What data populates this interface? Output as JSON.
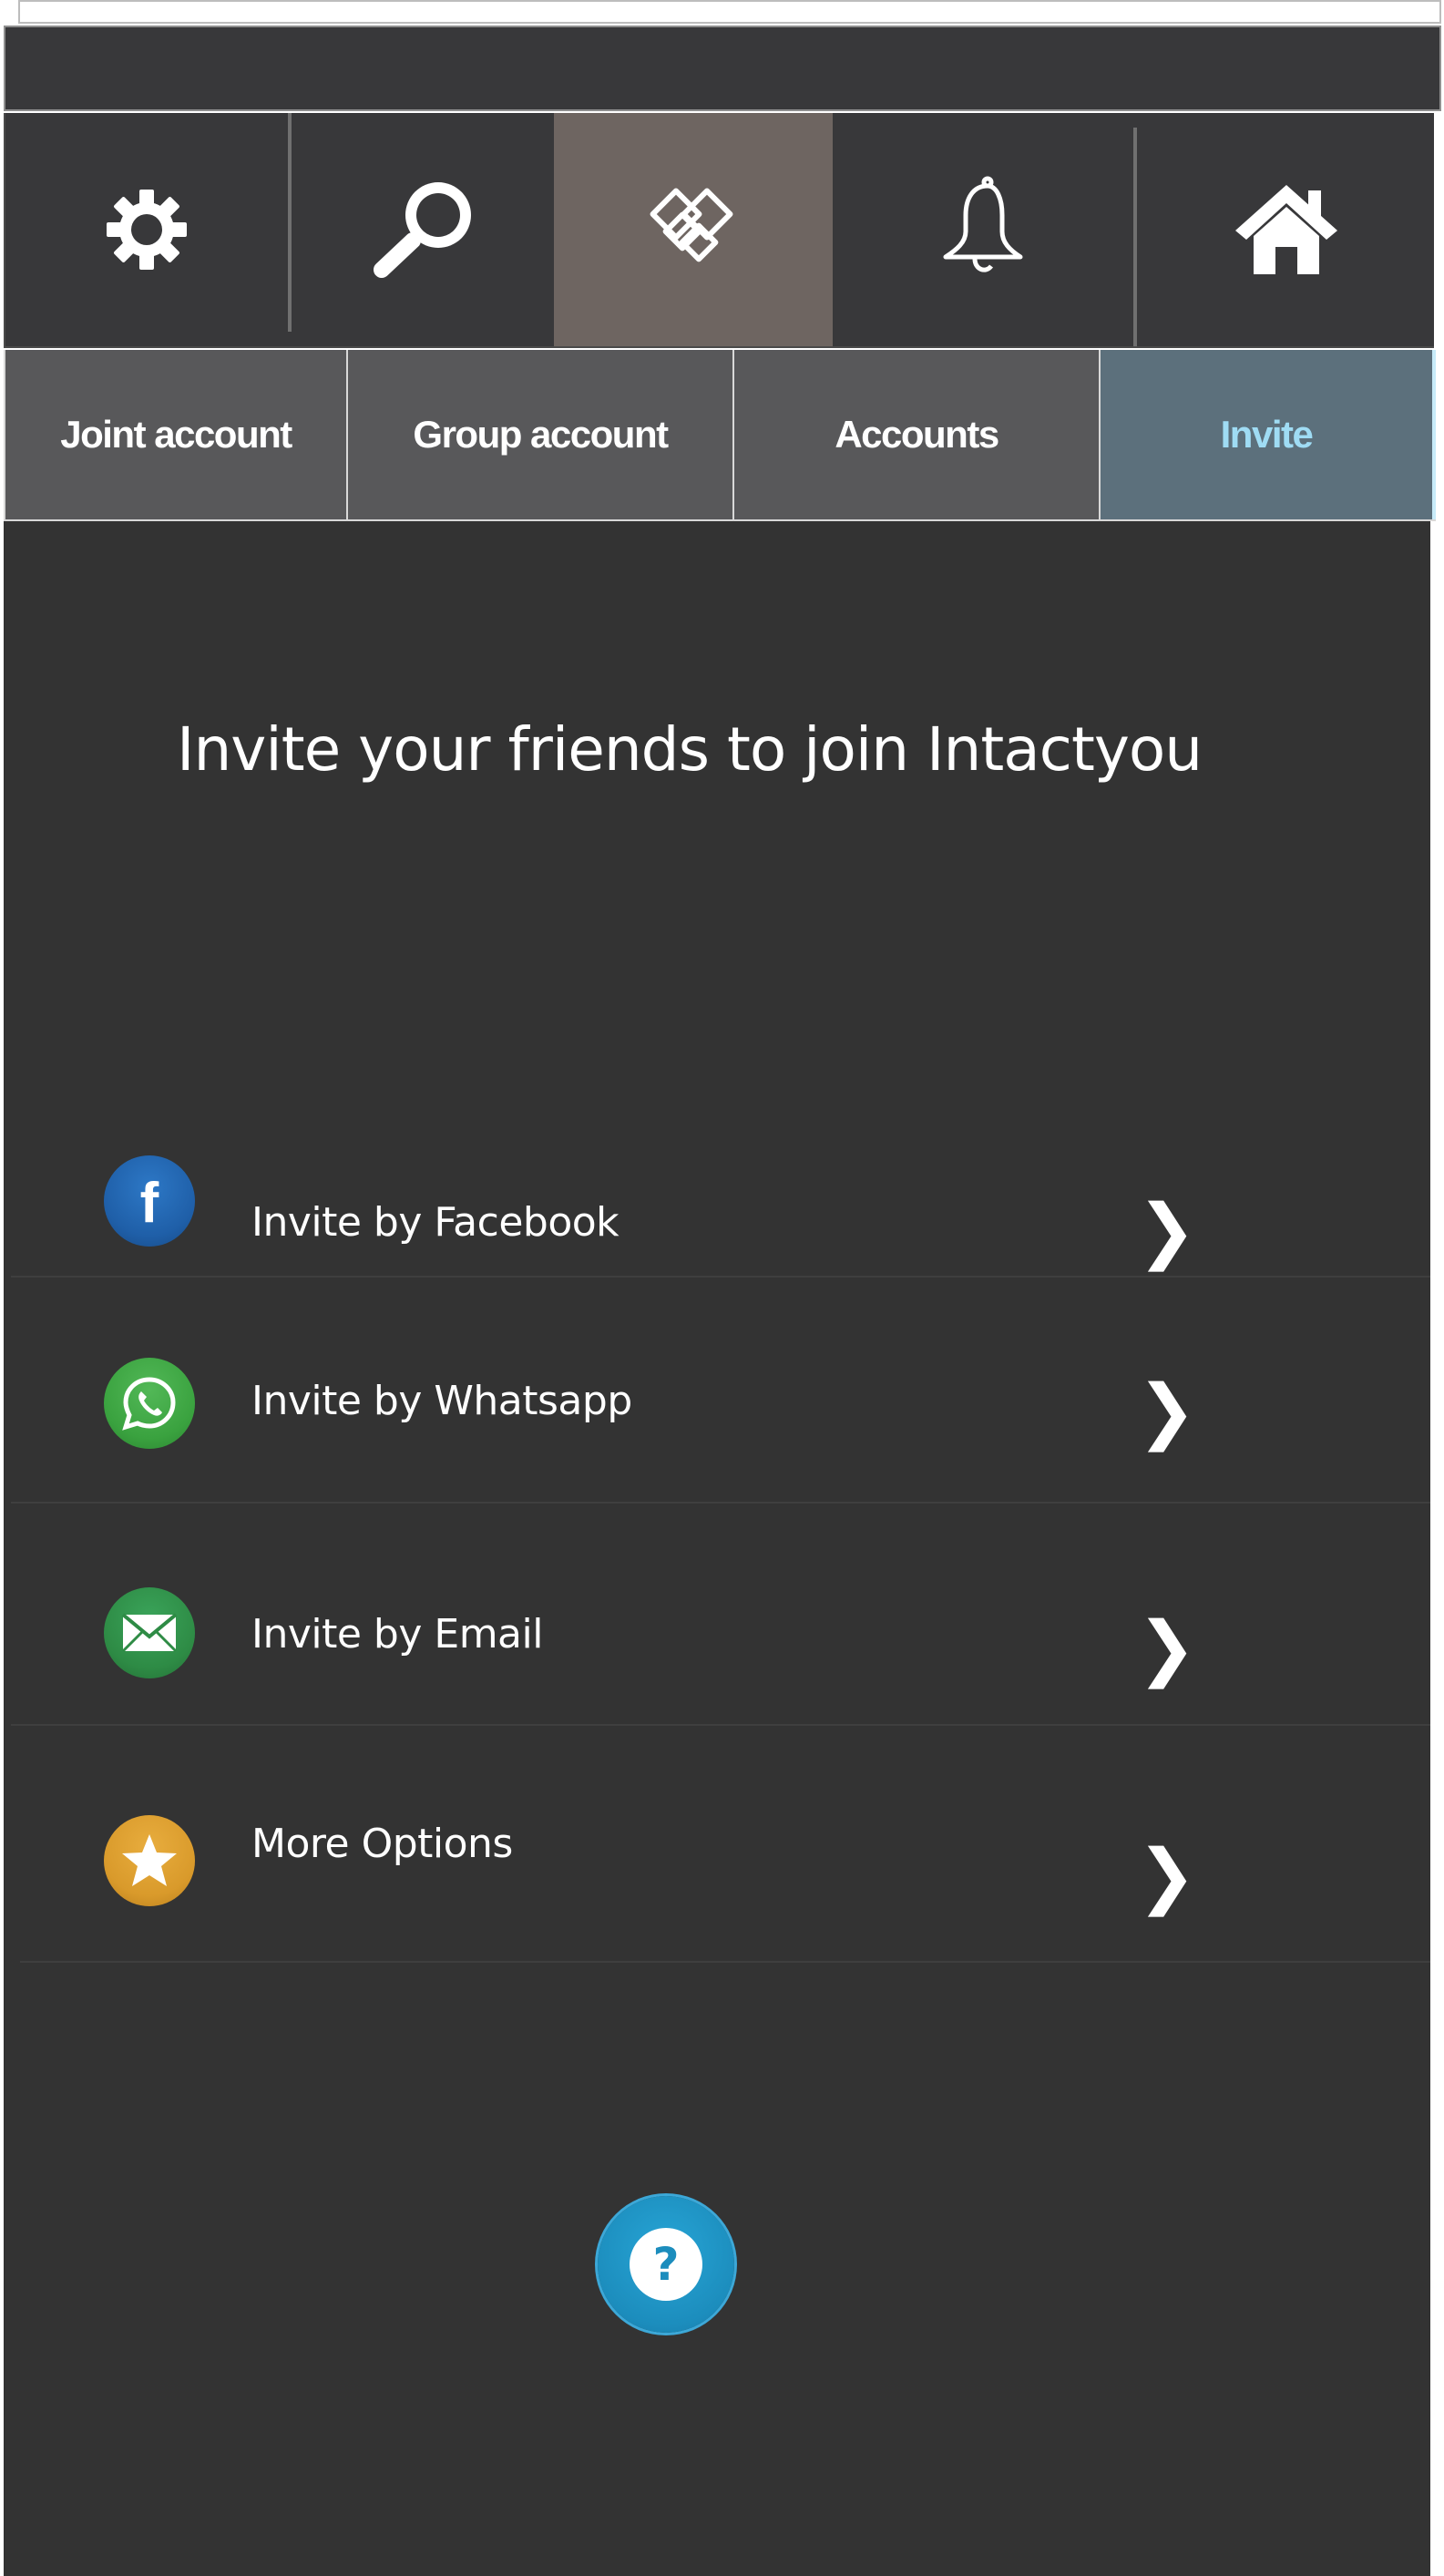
{
  "toolbar": {
    "icons": [
      "gear-icon",
      "search-icon",
      "handshake-icon",
      "bell-icon",
      "home-icon"
    ],
    "active_icon": "handshake-icon"
  },
  "tabs": [
    {
      "label": "Joint account",
      "active": false
    },
    {
      "label": "Group account",
      "active": false
    },
    {
      "label": "Accounts",
      "active": false
    },
    {
      "label": "Invite",
      "active": true
    }
  ],
  "main": {
    "headline": "Invite your friends to join Intactyou"
  },
  "invite_options": [
    {
      "label": "Invite by Facebook",
      "icon": "facebook-icon",
      "color": "#1f5fa8"
    },
    {
      "label": "Invite by Whatsapp",
      "icon": "whatsapp-icon",
      "color": "#3aa23f"
    },
    {
      "label": "Invite by Email",
      "icon": "email-icon",
      "color": "#2e8b45"
    },
    {
      "label": "More Options",
      "icon": "star-icon",
      "color": "#d99a2b"
    }
  ],
  "chevron": "❯",
  "help": {
    "label": "?"
  },
  "colors": {
    "background": "#333333",
    "bar": "#38383a",
    "active_icon_bg": "#6e6561",
    "active_tab_bg": "#5c707c",
    "active_tab_text": "#9fdcf4",
    "tab_bg": "#58585a"
  }
}
